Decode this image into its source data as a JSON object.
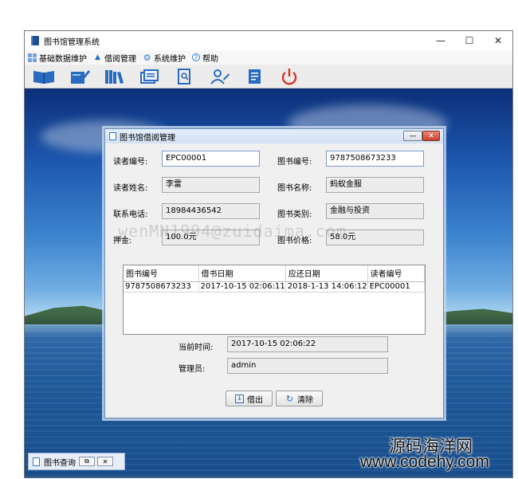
{
  "window": {
    "title": "图书馆管理系统",
    "controls": {
      "minimize": "—",
      "maximize": "☐",
      "close": "✕"
    }
  },
  "menu": [
    {
      "icon": "grid-icon",
      "label": "基础数据维护"
    },
    {
      "icon": "borrow-icon",
      "label": "借阅管理"
    },
    {
      "icon": "gear-icon",
      "label": "系统维护"
    },
    {
      "icon": "help-icon",
      "label": "帮助"
    }
  ],
  "toolbar_icons": [
    "book-icon",
    "notebook-icon",
    "bookshelf-icon",
    "reader-icon",
    "search-icon",
    "user-icon",
    "document-icon",
    "power-icon"
  ],
  "dialog": {
    "title": "图书馆借阅管理",
    "reader_id_label": "读者编号:",
    "reader_id_value": "EPC00001",
    "book_id_label": "图书编号:",
    "book_id_value": "9787508673233",
    "reader_name_label": "读者姓名:",
    "reader_name_value": "李雷",
    "book_name_label": "图书名称:",
    "book_name_value": "蚂蚁金服",
    "phone_label": "联系电话:",
    "phone_value": "18984436542",
    "book_type_label": "图书类别:",
    "book_type_value": "金融与投资",
    "deposit_label": "押金:",
    "deposit_value": "100.0元",
    "price_label": "图书价格:",
    "price_value": "58.0元",
    "table": {
      "columns": [
        "图书编号",
        "借书日期",
        "应还日期",
        "读者编号"
      ],
      "rows": [
        [
          "9787508673233",
          "2017-10-15 02:06:11",
          "2018-1-13 14:06:12",
          "EPC00001"
        ]
      ]
    },
    "current_time_label": "当前时间:",
    "current_time_value": "2017-10-15 02:06:22",
    "operator_label": "管理员:",
    "operator_value": "admin",
    "borrow_button": "借出",
    "clear_button": "清除"
  },
  "minimized_frame": {
    "title": "图书查询"
  },
  "watermarks": {
    "overlay": "wenMN1994@zuidaima.com",
    "site_cn": "源码海洋网",
    "site_url": "www.codehy.com"
  }
}
